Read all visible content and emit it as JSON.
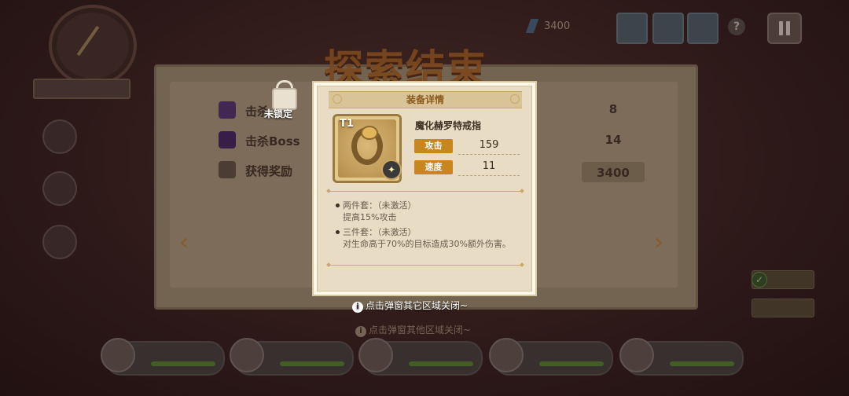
{
  "top_bar": {
    "gem_value": "3400"
  },
  "background": {
    "title": "探索结束",
    "stats": [
      {
        "label": "击杀",
        "value": "8"
      },
      {
        "label": "击杀Boss",
        "value": "14"
      },
      {
        "label": "获得奖励",
        "value": "3400"
      }
    ]
  },
  "lock": {
    "label": "未锁定"
  },
  "modal": {
    "title": "装备详情",
    "item": {
      "tier": "T1",
      "name": "魔化赫罗特戒指",
      "attributes": [
        {
          "label": "攻击",
          "value": "159"
        },
        {
          "label": "速度",
          "value": "11"
        }
      ]
    },
    "sets": [
      {
        "title": "两件套：（未激活）",
        "desc": "提高15%攻击"
      },
      {
        "title": "三件套：（未激活）",
        "desc": "对生命高于70%的目标造成30%额外伤害。"
      }
    ]
  },
  "hint": "点击弹窗其它区域关闭~",
  "bg_hint": "点击弹窗其他区域关闭~",
  "colors": {
    "accent": "#c8861f",
    "modal_bg": "#e8dcc4",
    "hp_green": "#5f8a36"
  }
}
